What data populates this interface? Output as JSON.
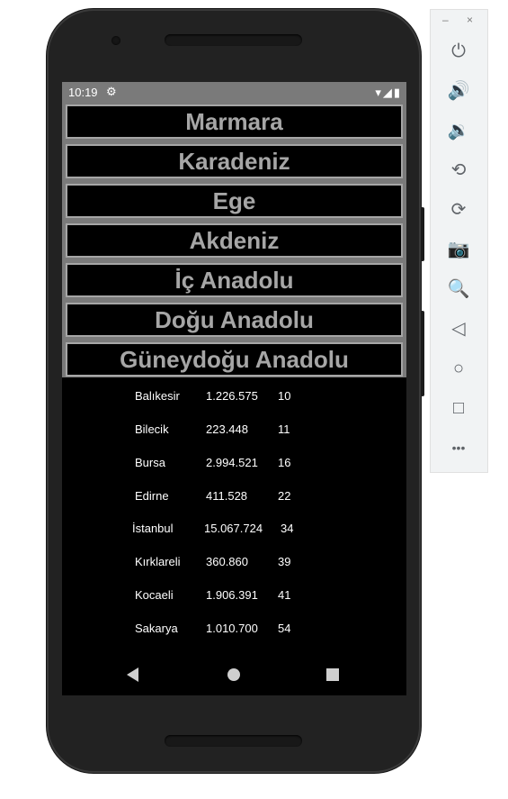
{
  "status_bar": {
    "time": "10:19",
    "gear_icon": "gear-icon",
    "wifi_icon": "wifi-icon",
    "signal_icon": "signal-icon",
    "battery_icon": "battery-icon"
  },
  "regions": [
    {
      "label": "Marmara"
    },
    {
      "label": "Karadeniz"
    },
    {
      "label": "Ege"
    },
    {
      "label": "Akdeniz"
    },
    {
      "label": "İç Anadolu"
    },
    {
      "label": "Doğu Anadolu"
    },
    {
      "label": "Güneydoğu Anadolu"
    }
  ],
  "provinces": [
    {
      "name": "Balıkesir",
      "population": "1.226.575",
      "code": "10"
    },
    {
      "name": "Bilecik",
      "population": "223.448",
      "code": "11"
    },
    {
      "name": "Bursa",
      "population": "2.994.521",
      "code": "16"
    },
    {
      "name": "Edirne",
      "population": "411.528",
      "code": "22"
    },
    {
      "name": "İstanbul",
      "population": "15.067.724",
      "code": "34"
    },
    {
      "name": "Kırklareli",
      "population": "360.860",
      "code": "39"
    },
    {
      "name": "Kocaeli",
      "population": "1.906.391",
      "code": "41"
    },
    {
      "name": "Sakarya",
      "population": "1.010.700",
      "code": "54"
    }
  ],
  "navbar": {
    "back_icon": "back-triangle-icon",
    "home_icon": "home-circle-icon",
    "recents_icon": "recents-square-icon"
  },
  "emulator_toolbar": {
    "minimize": "–",
    "close": "×",
    "buttons": [
      {
        "icon": "power-icon",
        "glyph": "⏻"
      },
      {
        "icon": "volume-up-icon",
        "glyph": "🔊"
      },
      {
        "icon": "volume-down-icon",
        "glyph": "🔉"
      },
      {
        "icon": "rotate-left-icon",
        "glyph": "⟲"
      },
      {
        "icon": "rotate-right-icon",
        "glyph": "⟳"
      },
      {
        "icon": "camera-icon",
        "glyph": "📷"
      },
      {
        "icon": "zoom-icon",
        "glyph": "🔍"
      },
      {
        "icon": "back-icon",
        "glyph": "◁"
      },
      {
        "icon": "home-icon",
        "glyph": "○"
      },
      {
        "icon": "overview-icon",
        "glyph": "□"
      },
      {
        "icon": "more-icon",
        "glyph": "•••"
      }
    ]
  },
  "colors": {
    "screen_bg": "#000000",
    "region_text": "#a6a6a6",
    "region_border": "#a6a6a6",
    "status_bar_bg": "#7a7a7a",
    "phone_body": "#222222",
    "toolbar_bg": "#f1f3f4"
  }
}
